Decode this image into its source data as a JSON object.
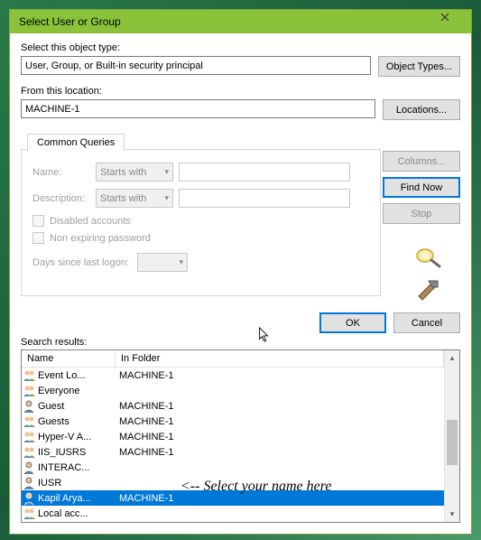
{
  "titlebar": {
    "title": "Select User or Group"
  },
  "labels": {
    "objectType": "Select this object type:",
    "location": "From this location:",
    "searchResults": "Search results:",
    "tab": "Common Queries",
    "nameLabel": "Name:",
    "descLabel": "Description:",
    "disabled": "Disabled accounts",
    "nonExpiring": "Non expiring password",
    "daysSince": "Days since last logon:",
    "startsWith": "Starts with"
  },
  "fields": {
    "objectType": "User, Group, or Built-in security principal",
    "location": "MACHINE-1"
  },
  "buttons": {
    "objectTypes": "Object Types...",
    "locations": "Locations...",
    "columns": "Columns...",
    "findNow": "Find Now",
    "stop": "Stop",
    "ok": "OK",
    "cancel": "Cancel"
  },
  "headers": {
    "name": "Name",
    "folder": "In Folder"
  },
  "rows": [
    {
      "name": "Event Lo...",
      "folder": "MACHINE-1",
      "icon": "group"
    },
    {
      "name": "Everyone",
      "folder": "",
      "icon": "group"
    },
    {
      "name": "Guest",
      "folder": "MACHINE-1",
      "icon": "user"
    },
    {
      "name": "Guests",
      "folder": "MACHINE-1",
      "icon": "group"
    },
    {
      "name": "Hyper-V A...",
      "folder": "MACHINE-1",
      "icon": "group"
    },
    {
      "name": "IIS_IUSRS",
      "folder": "MACHINE-1",
      "icon": "group"
    },
    {
      "name": "INTERAC...",
      "folder": "",
      "icon": "user"
    },
    {
      "name": "IUSR",
      "folder": "",
      "icon": "user"
    },
    {
      "name": "Kapil Arya...",
      "folder": "MACHINE-1",
      "icon": "user",
      "selected": true
    },
    {
      "name": "Local acc...",
      "folder": "",
      "icon": "group"
    }
  ],
  "annotation": "<-- Select your name here"
}
